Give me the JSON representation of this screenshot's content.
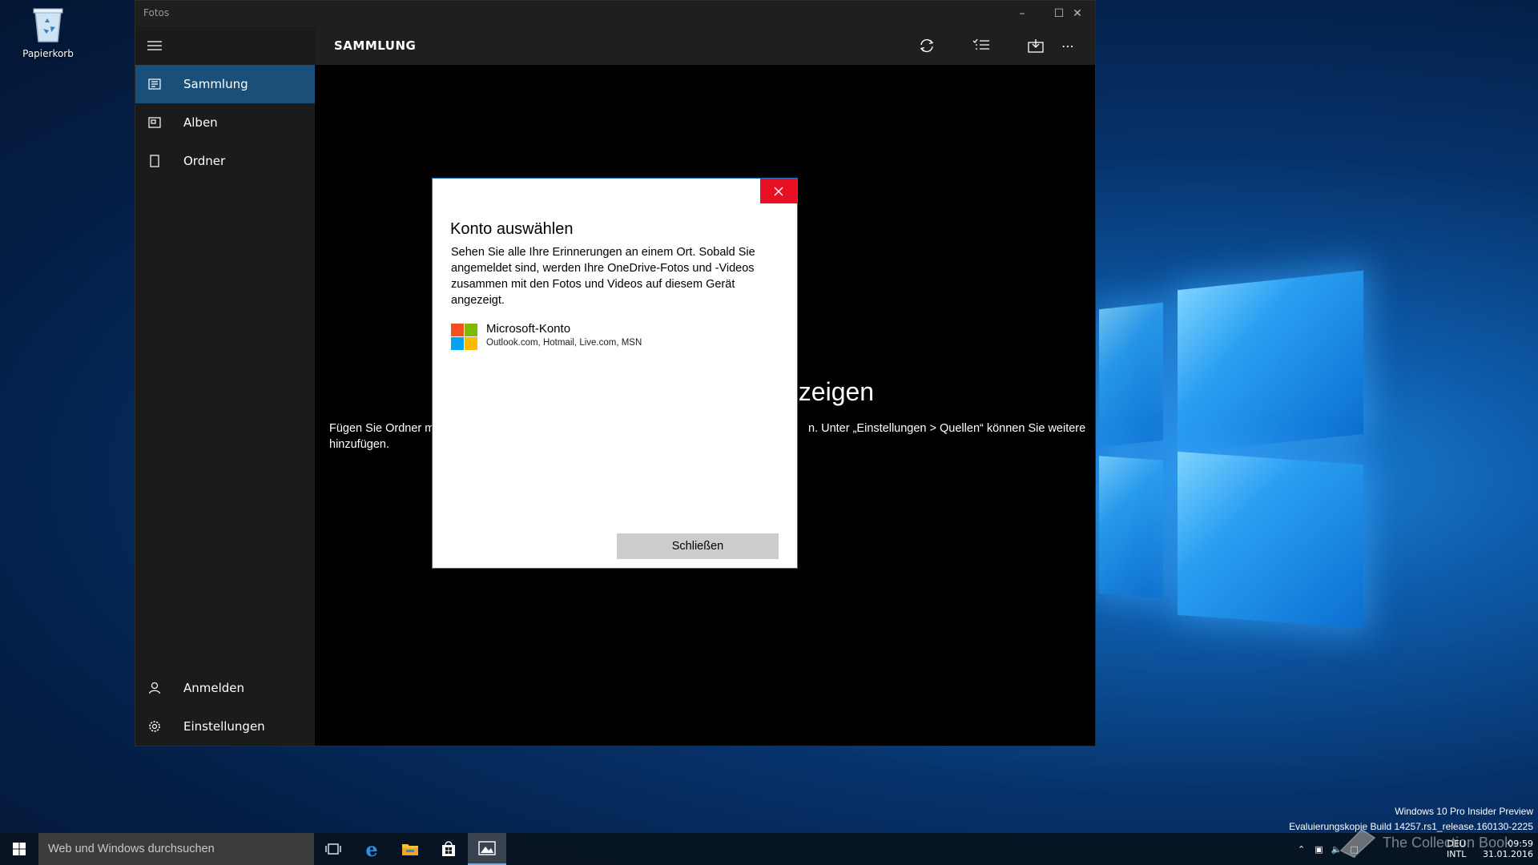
{
  "desktop": {
    "recycle_bin_label": "Papierkorb",
    "watermark_line1": "Windows 10 Pro Insider Preview",
    "watermark_line2": "Evaluierungskopie Build 14257.rs1_release.160130-2225",
    "overlay_text": "The Collection Book"
  },
  "window": {
    "title": "Fotos",
    "minimize_icon": "minimize-icon",
    "maximize_icon": "maximize-icon",
    "close_icon": "close-icon"
  },
  "sidebar": {
    "menu_icon": "hamburger-icon",
    "items": [
      {
        "label": "Sammlung",
        "icon": "collection-icon",
        "active": true
      },
      {
        "label": "Alben",
        "icon": "album-icon",
        "active": false
      },
      {
        "label": "Ordner",
        "icon": "folder-icon",
        "active": false
      }
    ],
    "bottom_items": [
      {
        "label": "Anmelden",
        "icon": "person-icon"
      },
      {
        "label": "Einstellungen",
        "icon": "gear-icon"
      }
    ]
  },
  "commandbar": {
    "heading": "SAMMLUNG",
    "buttons": [
      "refresh-icon",
      "select-icon",
      "import-icon",
      "more-icon"
    ]
  },
  "background": {
    "heading_fragment": "nzeigen",
    "body_left": "Fügen Sie Ordner m",
    "body_right": "n. Unter „Einstellungen > Quellen“ können Sie weitere",
    "body_line2": "hinzufügen."
  },
  "dialog": {
    "title": "Konto auswählen",
    "body": "Sehen Sie alle Ihre Erinnerungen an einem Ort. Sobald Sie angemeldet sind, werden Ihre OneDrive-Fotos und -Videos zusammen mit den Fotos und Videos auf diesem Gerät angezeigt.",
    "account_name": "Microsoft-Konto",
    "account_sub": "Outlook.com, Hotmail, Live.com, MSN",
    "close_button": "Schließen"
  },
  "taskbar": {
    "search_placeholder": "Web und Windows durchsuchen",
    "apps": [
      "task-view-icon",
      "edge-icon",
      "file-explorer-icon",
      "store-icon",
      "photos-icon"
    ],
    "language": "DEU",
    "keyboard": "INTL",
    "time": "09:59",
    "date": "31.01.2016"
  },
  "colors": {
    "accent": "#1a4f7a",
    "dialog_close": "#e81123",
    "desktop_blue": "#0d5aa8"
  }
}
